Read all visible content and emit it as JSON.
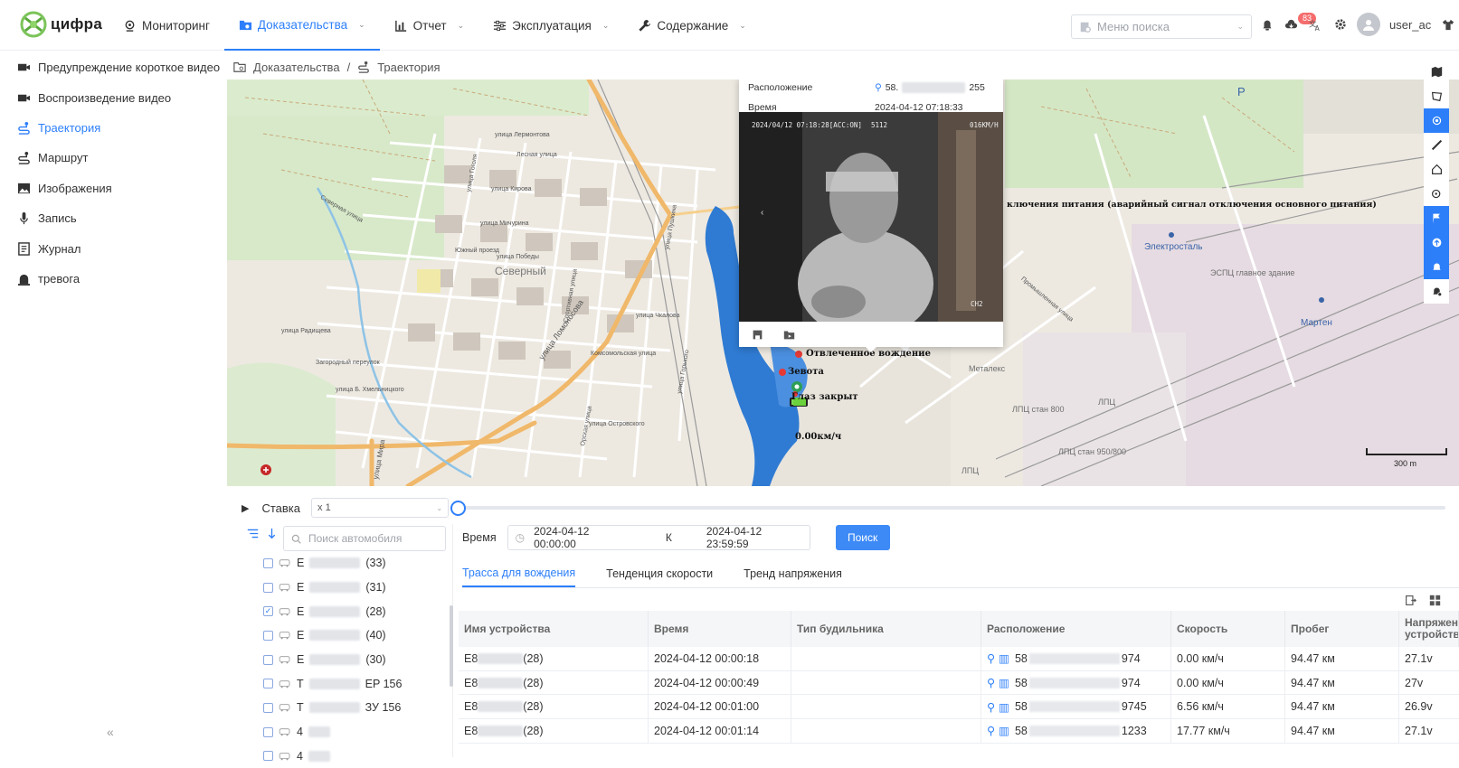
{
  "app": {
    "logo_text": "цифра"
  },
  "nav": [
    {
      "label": "Мониторинг"
    },
    {
      "label": "Доказательства"
    },
    {
      "label": "Отчет"
    },
    {
      "label": "Эксплуатация"
    },
    {
      "label": "Содержание"
    }
  ],
  "header": {
    "search_placeholder": "Меню поиска",
    "notification_count": "83",
    "username": "user_ac"
  },
  "sidebar": {
    "items": [
      {
        "label": "Предупреждение короткое видео"
      },
      {
        "label": "Воспроизведение видео"
      },
      {
        "label": "Траектория"
      },
      {
        "label": "Маршрут"
      },
      {
        "label": "Изображения"
      },
      {
        "label": "Запись"
      },
      {
        "label": "Журнал"
      },
      {
        "label": "тревога"
      }
    ],
    "collapse": "«"
  },
  "breadcrumb": {
    "root": "Доказательства",
    "sep": "/",
    "current": "Траектория"
  },
  "map": {
    "popup": {
      "location_key": "Расположение",
      "location_value": "58.",
      "location_tail": "255",
      "time_key": "Время",
      "time_value": "2024-04-12 07:18:33",
      "video_osd_time": "2024/04/12 07:18:28[ACC:ON]",
      "video_osd_id": "5112",
      "video_osd_speed": "016KM/H",
      "video_osd_ch": "CH2"
    },
    "alarm_text": "ключения питания (аварийный сигнал отключения основного питания)",
    "events": [
      {
        "label": "Отвлеченное вождение"
      },
      {
        "label": "Зевота"
      },
      {
        "label": "Глаз закрыт"
      }
    ],
    "speed": "0.00км/ч",
    "scale": "300 m",
    "labels": {
      "severny": "Северный",
      "elektrostal": "Электросталь",
      "marten": "Мартен",
      "metaleks": "Металекс",
      "espts": "ЭСПЦ главное здание",
      "lpts1": "ЛПЦ",
      "lpts2": "ЛПЦ стан 800",
      "lpts3": "ЛПЦ стан 950/800",
      "lpts4": "ЛПЦ",
      "parking": "P",
      "streets": [
        "улица Лермонтова",
        "Лесная улица",
        "улица Кирова",
        "улица Мичурина",
        "улица Победы",
        "улица Ломоносова",
        "Южный проезд",
        "улица Чкалова",
        "Комсомольская улица",
        "Северная улица",
        "улица Радищева",
        "Загородный переулок",
        "улица Б. Хмельницкого",
        "улица Островского",
        "улица Мира",
        "Промышленная улица",
        "улица Гоголя",
        "улица Пушкина",
        "Спортивная улица",
        "Орская улица",
        "улица Горького"
      ]
    }
  },
  "playback": {
    "rate_label": "Ставка",
    "rate_value": "x 1"
  },
  "vehicles": {
    "search_placeholder": "Поиск автомобиля",
    "items": [
      {
        "prefix": "E",
        "suffix": "(33)",
        "checked": false
      },
      {
        "prefix": "E",
        "suffix": "(31)",
        "checked": false
      },
      {
        "prefix": "E",
        "suffix": "(28)",
        "checked": true
      },
      {
        "prefix": "E",
        "suffix": "(40)",
        "checked": false
      },
      {
        "prefix": "E",
        "suffix": "(30)",
        "checked": false
      },
      {
        "prefix": "T",
        "suffix": "EP 156",
        "checked": false
      },
      {
        "prefix": "T",
        "suffix": "ЗУ 156",
        "checked": false
      },
      {
        "prefix": "4",
        "suffix": "",
        "checked": false
      },
      {
        "prefix": "4",
        "suffix": "",
        "checked": false
      }
    ]
  },
  "query": {
    "time_label": "Время",
    "start": "2024-04-12 00:00:00",
    "to": "К",
    "end": "2024-04-12 23:59:59",
    "search_btn": "Поиск"
  },
  "tabs": [
    {
      "label": "Трасса для вождения"
    },
    {
      "label": "Тенденция скорости"
    },
    {
      "label": "Тренд напряжения"
    }
  ],
  "table": {
    "headers": [
      "Имя устройства",
      "Время",
      "Тип будильника",
      "Расположение",
      "Скорость",
      "Пробег",
      "Напряжение устройства"
    ],
    "rows": [
      {
        "device_prefix": "E8",
        "device_suffix": "(28)",
        "time": "2024-04-12 00:00:18",
        "alarm": "",
        "loc_prefix": "58",
        "loc_suffix": "974",
        "speed": "0.00 км/ч",
        "mileage": "94.47 км",
        "voltage": "27.1v"
      },
      {
        "device_prefix": "E8",
        "device_suffix": "(28)",
        "time": "2024-04-12 00:00:49",
        "alarm": "",
        "loc_prefix": "58",
        "loc_suffix": "974",
        "speed": "0.00 км/ч",
        "mileage": "94.47 км",
        "voltage": "27v"
      },
      {
        "device_prefix": "E8",
        "device_suffix": "(28)",
        "time": "2024-04-12 00:01:00",
        "alarm": "",
        "loc_prefix": "58",
        "loc_suffix": "9745",
        "speed": "6.56 км/ч",
        "mileage": "94.47 км",
        "voltage": "26.9v"
      },
      {
        "device_prefix": "E8",
        "device_suffix": "(28)",
        "time": "2024-04-12 00:01:14",
        "alarm": "",
        "loc_prefix": "58",
        "loc_suffix": "1233",
        "speed": "17.77 км/ч",
        "mileage": "94.47 км",
        "voltage": "27.1v"
      }
    ]
  },
  "colors": {
    "accent": "#2d7ff9",
    "map_bg": "#ede9e1",
    "water": "#2f7bd3",
    "road": "#f0b86a"
  }
}
